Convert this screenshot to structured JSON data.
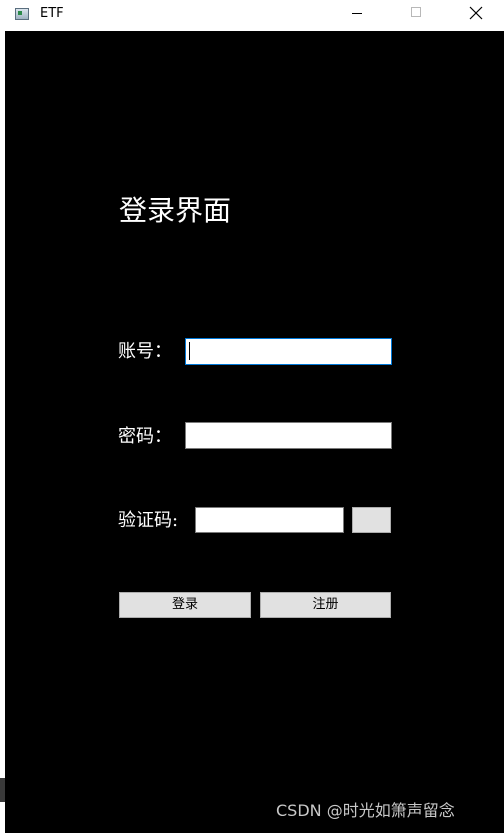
{
  "window": {
    "title": "ETF",
    "minimize_icon": "minimize-icon",
    "maximize_icon": "maximize-icon",
    "close_icon": "close-icon"
  },
  "form": {
    "heading": "登录界面",
    "account_label": "账号：",
    "account_value": "",
    "password_label": "密码：",
    "password_value": "",
    "captcha_label": "验证码:",
    "captcha_value": "",
    "login_button": "登录",
    "register_button": "注册"
  },
  "watermark": "CSDN @时光如箫声留念",
  "colors": {
    "background": "#000000",
    "text": "#ffffff",
    "focus_border": "#0078d7",
    "button_face": "#e1e1e1"
  }
}
